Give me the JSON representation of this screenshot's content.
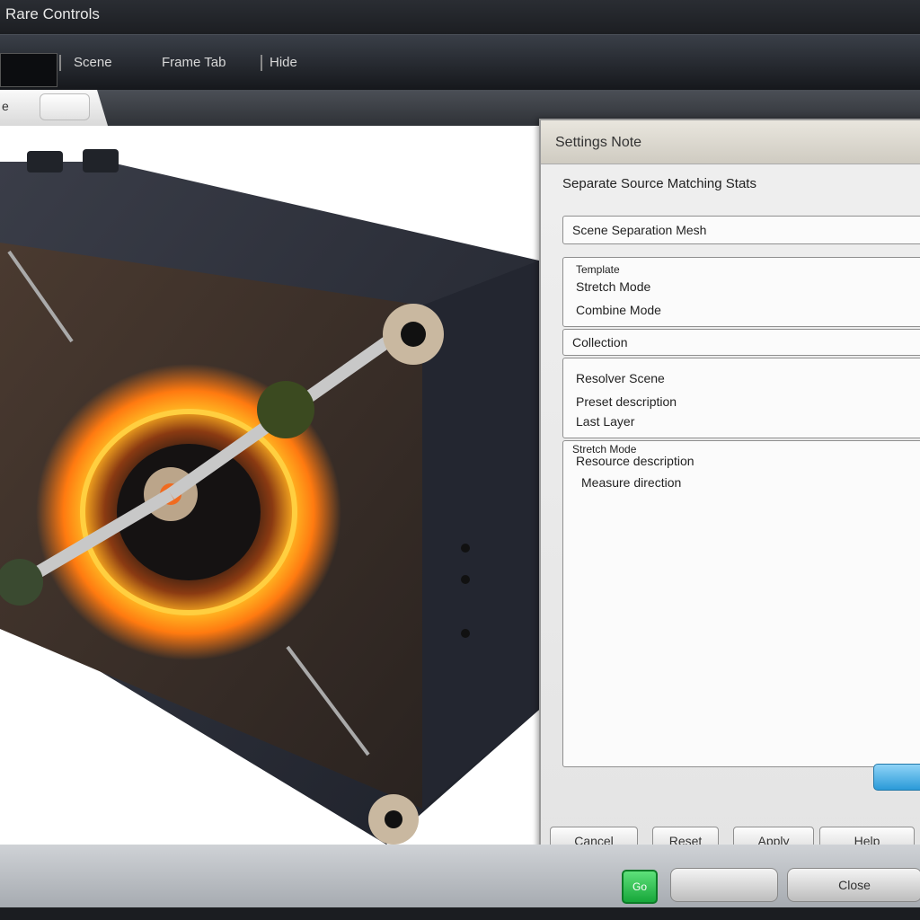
{
  "window": {
    "title": "Rare Controls"
  },
  "toolbar": {
    "items": [
      "Scene",
      "Frame Tab",
      "Hide"
    ]
  },
  "tabs": {
    "active_label": "e"
  },
  "dialog": {
    "title": "Settings Note",
    "subtitle": "Separate Source Matching Stats",
    "fields": [
      {
        "label": "Scene Separation Mesh",
        "lines": []
      },
      {
        "label": "",
        "lines": [
          "Template",
          "Stretch Mode",
          "Combine Mode"
        ]
      },
      {
        "label": "Collection",
        "lines": []
      },
      {
        "label": "",
        "lines": [
          "Resolver Scene",
          "Preset description",
          "Last Layer"
        ]
      },
      {
        "label": "Stretch Mode",
        "lines": [
          "Resource description",
          "Measure direction"
        ]
      }
    ],
    "buttons": [
      "Cancel",
      "Reset",
      "Apply",
      "Help"
    ],
    "ok_label": ""
  },
  "bottom": {
    "green_label": "Go",
    "gray_buttons": [
      "",
      "Close"
    ]
  },
  "colors": {
    "accent": "#2a9ad8",
    "go": "#17a73a",
    "fire": "#ff8a1a"
  },
  "icons": {
    "green_button": "go-icon"
  }
}
